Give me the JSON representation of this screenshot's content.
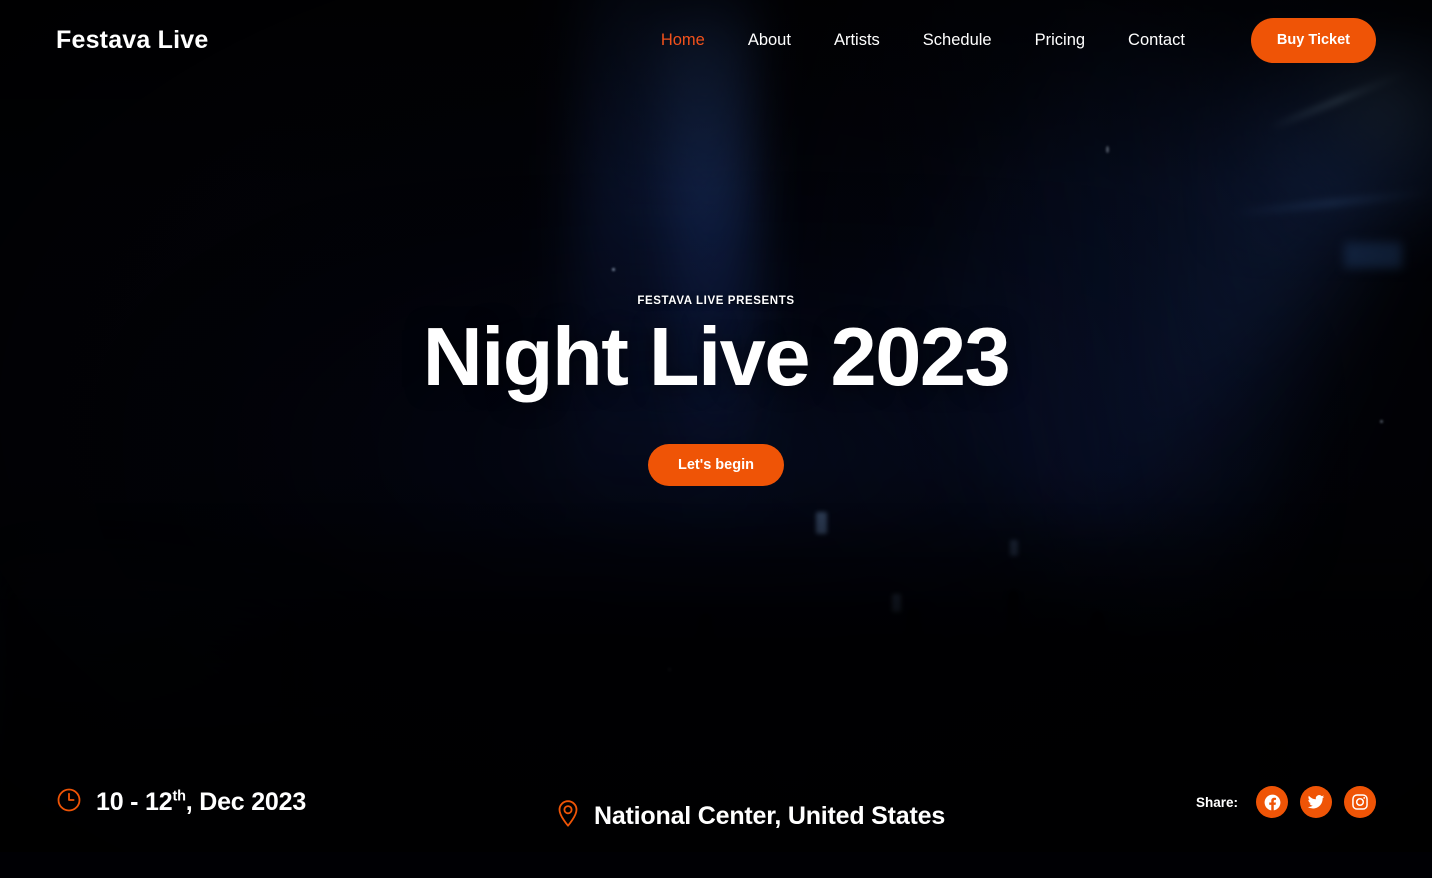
{
  "meta": {
    "accent_color": "#ef5406",
    "active_nav_color": "#f1511b",
    "text_color": "#ffffff",
    "background_color": "#000004"
  },
  "header": {
    "logo": "Festava Live",
    "nav": [
      {
        "label": "Home",
        "active": true
      },
      {
        "label": "About",
        "active": false
      },
      {
        "label": "Artists",
        "active": false
      },
      {
        "label": "Schedule",
        "active": false
      },
      {
        "label": "Pricing",
        "active": false
      },
      {
        "label": "Contact",
        "active": false
      }
    ],
    "cta_label": "Buy Ticket"
  },
  "hero": {
    "eyebrow": "FESTAVA LIVE PRESENTS",
    "title": "Night Live 2023",
    "cta_label": "Let's begin"
  },
  "infobar": {
    "date": {
      "icon": "clock-icon",
      "prefix": "10 - 12",
      "ordinal": "th",
      "suffix": ", Dec 2023"
    },
    "location": {
      "icon": "map-pin-icon",
      "text": "National Center, United States"
    },
    "share": {
      "label": "Share:",
      "links": [
        {
          "name": "facebook",
          "title": "Facebook"
        },
        {
          "name": "twitter",
          "title": "Twitter"
        },
        {
          "name": "instagram",
          "title": "Instagram"
        }
      ]
    }
  }
}
